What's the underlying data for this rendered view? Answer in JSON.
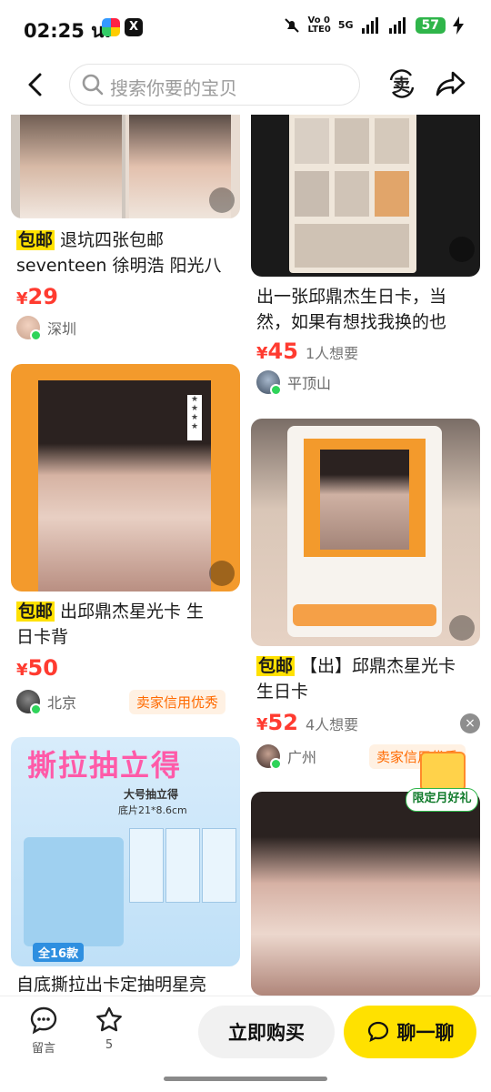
{
  "status_bar": {
    "time": "02:25 น.",
    "signal_text_top": "Vo 0",
    "signal_text_bottom": "LTE0",
    "net_5g": "5G",
    "battery": "57"
  },
  "search": {
    "placeholder": "搜索你要的宝贝"
  },
  "header": {
    "sell_label": "卖"
  },
  "items": [
    {
      "tag": "包邮",
      "title_line1": "退坑四张包邮",
      "title_line2": "seventeen 徐明浩 阳光八",
      "currency": "¥",
      "price": "29",
      "location": "深圳"
    },
    {
      "tag": "",
      "title_line1": "出一张邱鼎杰生日卡，当",
      "title_line2": "然，如果有想找我换的也",
      "currency": "¥",
      "price": "45",
      "wants": "1人想要",
      "location": "平顶山"
    },
    {
      "tag": "包邮",
      "title_line1": "出邱鼎杰星光卡 生",
      "title_line2": "日卡背",
      "currency": "¥",
      "price": "50",
      "location": "北京",
      "badge": "卖家信用优秀"
    },
    {
      "tag": "包邮",
      "title_line1": "【出】邱鼎杰星光卡",
      "title_line2": "生日卡",
      "currency": "¥",
      "price": "52",
      "wants": "4人想要",
      "location": "广州",
      "badge": "卖家信用优秀"
    },
    {
      "title_line1": "自底撕拉出卡定抽明星亮"
    }
  ],
  "poster": {
    "headline": "撕拉抽立得",
    "size_title": "大号抽立得",
    "size": "底片21*8.6cm",
    "count": "全16款"
  },
  "promo": {
    "label": "限定月好礼",
    "close": "×"
  },
  "bottom_bar": {
    "comment_label": "留言",
    "fav_count": "5",
    "buy_label": "立即购买",
    "chat_label": "聊一聊"
  },
  "colors": {
    "accent_yellow": "#ffe100",
    "price_red": "#ff3b30",
    "credit_orange": "#ff6a00"
  }
}
